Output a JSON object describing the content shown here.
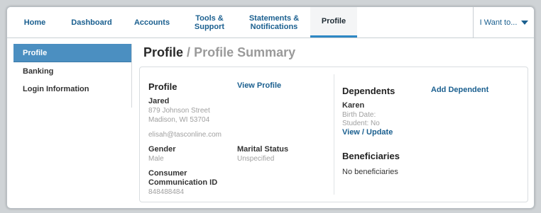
{
  "nav": {
    "items": [
      {
        "label": "Home"
      },
      {
        "label": "Dashboard"
      },
      {
        "label": "Accounts"
      },
      {
        "label": "Tools &\nSupport"
      },
      {
        "label": "Statements &\nNotifications"
      },
      {
        "label": "Profile"
      }
    ],
    "want_label": "I Want to...",
    "active": "Profile"
  },
  "sidebar": {
    "items": [
      {
        "label": "Profile"
      },
      {
        "label": "Banking"
      },
      {
        "label": "Login Information"
      }
    ]
  },
  "page": {
    "title": "Profile",
    "separator": "/",
    "subtitle": "Profile Summary"
  },
  "profile": {
    "heading": "Profile",
    "view_link": "View Profile",
    "name": "Jared",
    "address1": "879 Johnson Street",
    "address2": "Madison, WI 53704",
    "email": "elisah@tasconline.com",
    "gender_label": "Gender",
    "gender_value": "Male",
    "marital_label": "Marital Status",
    "marital_value": "Unspecified",
    "comm_label_1": "Consumer",
    "comm_label_2": "Communication ID",
    "comm_value": "848488484"
  },
  "dependents": {
    "heading": "Dependents",
    "add_link": "Add Dependent",
    "name": "Karen",
    "birth_date": "Birth Date:",
    "student": "Student: No",
    "view_update": "View / Update"
  },
  "beneficiaries": {
    "heading": "Beneficiaries",
    "empty_text": "No beneficiaries"
  },
  "colors": {
    "accent": "#4b8fc1",
    "link": "#1a5f8f",
    "active_tab_border": "#2d88c4"
  }
}
